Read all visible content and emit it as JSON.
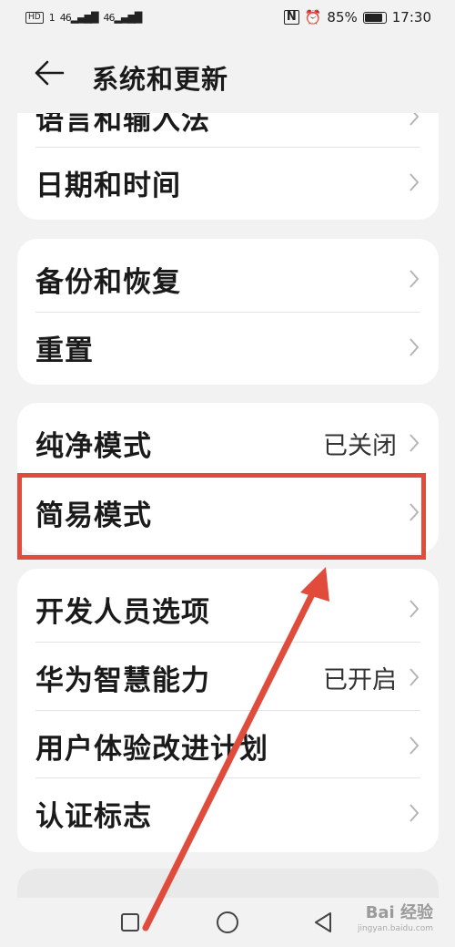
{
  "status_bar": {
    "left_badge": "HD",
    "sim1": "1",
    "net1": "46",
    "net2": "46",
    "nfc_label": "N",
    "battery": "85%",
    "time": "17:30"
  },
  "header": {
    "title": "系统和更新"
  },
  "card1": {
    "items": [
      {
        "label": "语言和输入法"
      },
      {
        "label": "日期和时间"
      }
    ]
  },
  "card2": {
    "items": [
      {
        "label": "备份和恢复"
      },
      {
        "label": "重置"
      }
    ]
  },
  "card3": {
    "items": [
      {
        "label": "纯净模式",
        "value": "已关闭"
      },
      {
        "label": "简易模式"
      }
    ]
  },
  "card4": {
    "items": [
      {
        "label": "开发人员选项"
      },
      {
        "label": "华为智慧能力",
        "value": "已开启"
      },
      {
        "label": "用户体验改进计划"
      },
      {
        "label": "认证标志"
      }
    ]
  },
  "watermark": {
    "brand": "Bai 经验",
    "url": "jingyan.baidu.com"
  },
  "colors": {
    "highlight": "#e14b3b",
    "background": "#f2f2f2",
    "card": "#ffffff"
  }
}
